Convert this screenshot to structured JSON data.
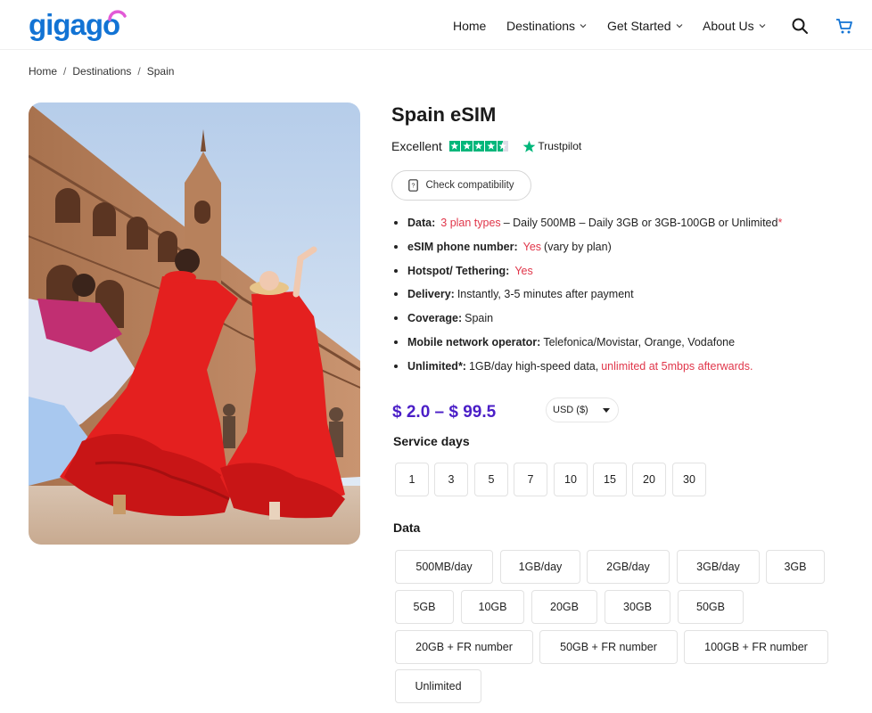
{
  "header": {
    "logo_text": "gigago",
    "nav": [
      {
        "label": "Home",
        "has_dropdown": false
      },
      {
        "label": "Destinations",
        "has_dropdown": true
      },
      {
        "label": "Get Started",
        "has_dropdown": true
      },
      {
        "label": "About Us",
        "has_dropdown": true
      }
    ],
    "icons": [
      "search-icon",
      "cart-icon"
    ],
    "brand_color": "#1273d4"
  },
  "breadcrumb": [
    "Home",
    "Destinations",
    "Spain"
  ],
  "product": {
    "title": "Spain eSIM",
    "rating_word": "Excellent",
    "trustpilot_label": "Trustpilot",
    "trustpilot_stars": 4.5,
    "compat_button": "Check compatibility",
    "features": [
      {
        "label": "Data:",
        "highlight": "3 plan types",
        "rest": "– Daily 500MB – Daily 3GB or 3GB-100GB or Unlimited",
        "suffix": "*"
      },
      {
        "label": "eSIM phone number:",
        "highlight": "Yes",
        "rest": "(vary by plan)"
      },
      {
        "label": "Hotspot/ Tethering:",
        "highlight": "Yes",
        "rest": ""
      },
      {
        "label": "Delivery:",
        "highlight": "",
        "rest": "Instantly, 3-5 minutes after payment"
      },
      {
        "label": "Coverage:",
        "highlight": "",
        "rest": "Spain"
      },
      {
        "label": "Mobile network operator:",
        "highlight": "",
        "rest": "Telefonica/Movistar, Orange, Vodafone"
      },
      {
        "label": "Unlimited*:",
        "highlight": "",
        "rest": "1GB/day high-speed data,",
        "suffix": "unlimited at 5mbps afterwards."
      }
    ],
    "price_range": "$ 2.0 – $ 99.5",
    "currency": "USD ($)",
    "accent_red": "#e0364a",
    "price_color": "#4b1fc7"
  },
  "service_days": {
    "label": "Service days",
    "options": [
      "1",
      "3",
      "5",
      "7",
      "10",
      "15",
      "20",
      "30"
    ]
  },
  "data_plans": {
    "label": "Data",
    "rows": [
      [
        "500MB/day",
        "1GB/day",
        "2GB/day",
        "3GB/day",
        "3GB"
      ],
      [
        "5GB",
        "10GB",
        "20GB",
        "30GB",
        "50GB"
      ],
      [
        "20GB + FR number",
        "50GB + FR number",
        "100GB + FR number"
      ],
      [
        "Unlimited"
      ]
    ]
  }
}
